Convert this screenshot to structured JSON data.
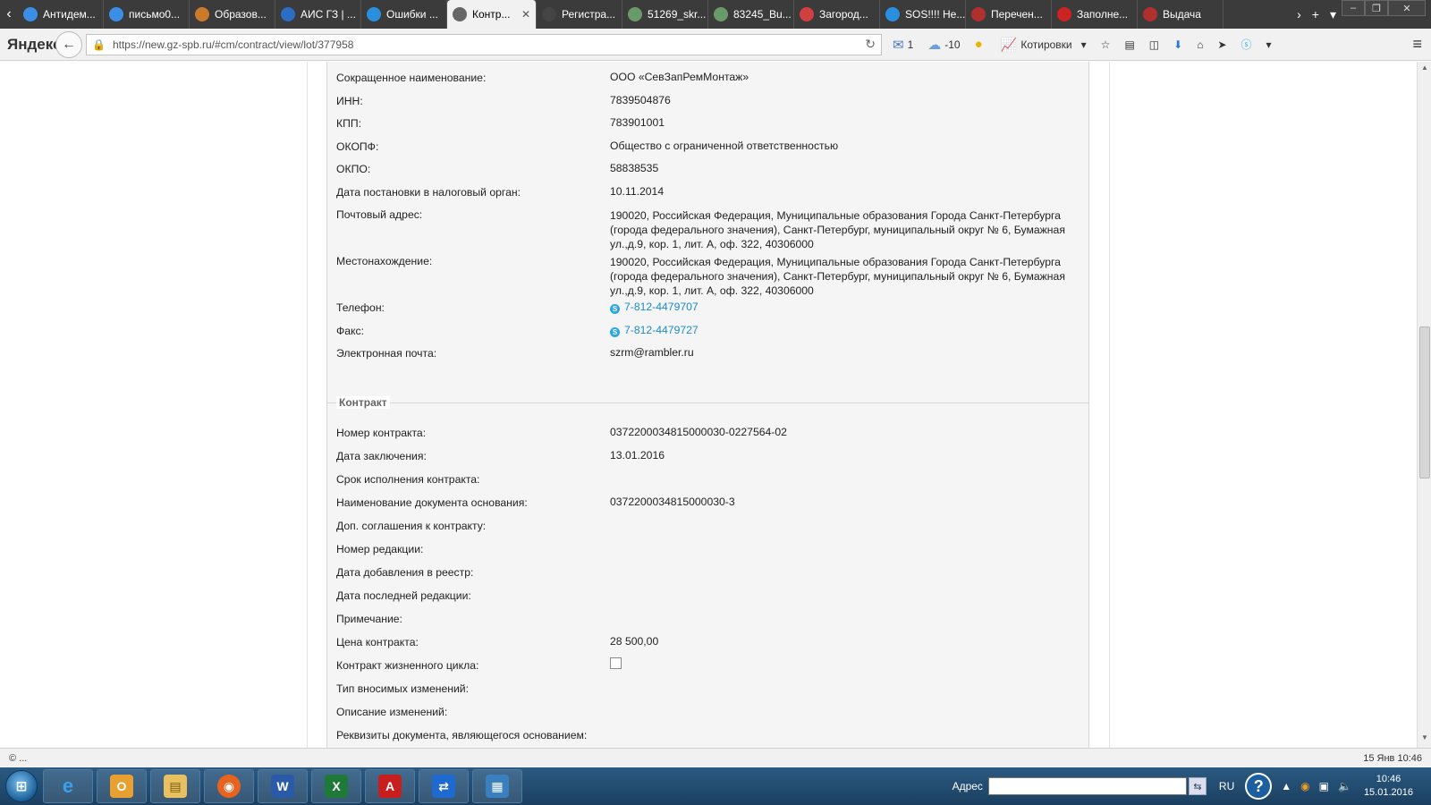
{
  "browser": {
    "tabs": [
      {
        "label": "Антидем...",
        "color": "#3a8ee6"
      },
      {
        "label": "письмо0...",
        "color": "#3a8ee6"
      },
      {
        "label": "Образов...",
        "color": "#c97a2a"
      },
      {
        "label": "АИС ГЗ | ...",
        "color": "#2b6cc4"
      },
      {
        "label": "Ошибки ...",
        "color": "#2b8fe0"
      },
      {
        "label": "Контр...",
        "color": "#666666"
      },
      {
        "label": "Регистра...",
        "color": "#444444"
      },
      {
        "label": "51269_skr...",
        "color": "#6a9a6a"
      },
      {
        "label": "83245_Bu...",
        "color": "#6a9a6a"
      },
      {
        "label": "Загород...",
        "color": "#d04040"
      },
      {
        "label": "SOS!!!! Не...",
        "color": "#2b8fe0"
      },
      {
        "label": "Перечен...",
        "color": "#b03030"
      },
      {
        "label": "Заполне...",
        "color": "#cc2222"
      },
      {
        "label": "Выдача",
        "color": "#b03030"
      }
    ],
    "logo": "Яндекс",
    "url": "https://new.gz-spb.ru/#cm/contract/view/lot/377958",
    "mail_count": "1",
    "weather": "-10",
    "quotes_label": "Котировки"
  },
  "org": {
    "rows": [
      {
        "label": "Сокращенное наименование:",
        "value": "ООО «СевЗапРемМонтаж»"
      },
      {
        "label": "ИНН:",
        "value": "7839504876"
      },
      {
        "label": "КПП:",
        "value": "783901001"
      },
      {
        "label": "ОКОПФ:",
        "value": "Общество с ограниченной ответственностью"
      },
      {
        "label": "ОКПО:",
        "value": "58838535"
      },
      {
        "label": "Дата постановки в налоговый орган:",
        "value": "10.11.2014"
      },
      {
        "label": "Почтовый адрес:",
        "value": "190020, Российская Федерация, Муниципальные образования Города Санкт-Петербурга (города федерального значения), Санкт-Петербург, муниципальный округ № 6, Бумажная ул.,д.9, кор. 1, лит. А, оф. 322, 40306000"
      },
      {
        "label": "Местонахождение:",
        "value": "190020, Российская Федерация, Муниципальные образования Города Санкт-Петербурга (города федерального значения), Санкт-Петербург, муниципальный округ № 6, Бумажная ул.,д.9, кор. 1, лит. А, оф. 322, 40306000"
      },
      {
        "label": "Телефон:",
        "value": "7-812-4479707"
      },
      {
        "label": "Факс:",
        "value": "7-812-4479727"
      },
      {
        "label": "Электронная почта:",
        "value": "szrm@rambler.ru"
      }
    ]
  },
  "contract": {
    "legend": "Контракт",
    "rows": [
      {
        "label": "Номер контракта:",
        "value": "0372200034815000030-0227564-02"
      },
      {
        "label": "Дата заключения:",
        "value": "13.01.2016"
      },
      {
        "label": "Срок исполнения контракта:",
        "value": ""
      },
      {
        "label": "Наименование документа основания:",
        "value": "0372200034815000030-3"
      },
      {
        "label": "Доп. соглашения к контракту:",
        "value": ""
      },
      {
        "label": "Номер редакции:",
        "value": ""
      },
      {
        "label": "Дата добавления в реестр:",
        "value": ""
      },
      {
        "label": "Дата последней редакции:",
        "value": ""
      },
      {
        "label": "Примечание:",
        "value": ""
      },
      {
        "label": "Цена контракта:",
        "value": "28 500,00"
      },
      {
        "label": "Контракт жизненного цикла:",
        "value": ""
      },
      {
        "label": "Тип вносимых изменений:",
        "value": ""
      },
      {
        "label": "Описание изменений:",
        "value": ""
      },
      {
        "label": "Реквизиты документа, являющегося основанием:",
        "value": ""
      }
    ],
    "lifecycle_checked": false
  },
  "status": {
    "left": "© ...",
    "right": "15 Янв 10:46"
  },
  "taskbar": {
    "address_label": "Адрес",
    "lang": "RU",
    "time": "10:46",
    "date": "15.01.2016"
  }
}
